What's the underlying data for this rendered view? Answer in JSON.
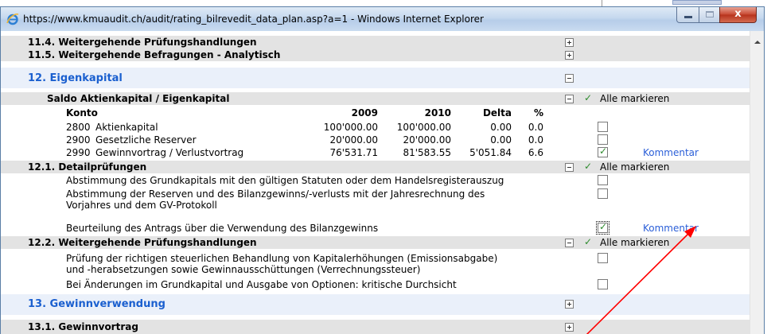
{
  "window": {
    "title": "https://www.kmuaudit.ch/audit/rating_bilrevedit_data_plan.asp?a=1 - Windows Internet Explorer",
    "minimize_icon": "minimize-icon",
    "maximize_icon": "maximize-icon",
    "close_icon": "close-icon",
    "close_glyph": "x"
  },
  "colors": {
    "section_title": "#1a5fcf",
    "check": "#2e8b2e",
    "link": "#2b5fd8",
    "annotation_arrow": "#ff0000"
  },
  "rows": {
    "r11_4": "11.4.  Weitergehende Prüfungshandlungen",
    "r11_5": "11.5.  Weitergehende Befragungen - Analytisch",
    "r12": "12. Eigenkapital",
    "saldo": "Saldo Aktienkapital / Eigenkapital",
    "mark_all": "Alle markieren",
    "comment": "Kommentar",
    "r12_1": "12.1.  Detailprüfungen",
    "r12_2": "12.2.  Weitergehende Prüfungshandlungen",
    "r13": "13. Gewinnverwendung",
    "r13_1": "13.1.  Gewinnvortrag"
  },
  "table": {
    "headers": {
      "konto": "Konto",
      "y2009": "2009",
      "y2010": "2010",
      "delta": "Delta",
      "pct": "%"
    },
    "rows": [
      {
        "konto": "2800",
        "name": "Aktienkapital",
        "y2009": "100'000.00",
        "y2010": "100'000.00",
        "delta": "0.00",
        "pct": "0.0",
        "checked": false
      },
      {
        "konto": "2900",
        "name": "Gesetzliche Reserver",
        "y2009": "20'000.00",
        "y2010": "20'000.00",
        "delta": "0.00",
        "pct": "0.0",
        "checked": false
      },
      {
        "konto": "2990",
        "name": "Gewinnvortrag / Verlustvortrag",
        "y2009": "76'531.71",
        "y2010": "81'583.55",
        "delta": "5'051.84",
        "pct": "6.6",
        "checked": true
      }
    ]
  },
  "detail_items": [
    "Abstimmung des Grundkapitals mit den gültigen Statuten oder dem Handelsregisterauszug",
    "Abstimmung der Reserven und des Bilanzgewinns/-verlusts mit der Jahresrechnung des",
    "Vorjahres und dem GV-Protokoll",
    "Beurteilung des Antrags über die Verwendung des Bilanzgewinns"
  ],
  "further_items": [
    "Prüfung der richtigen steuerlichen Behandlung von Kapitalerhöhungen (Emissionsabgabe)",
    "und -herabsetzungen sowie Gewinnausschüttungen (Verrechnungssteuer)",
    "Bei Änderungen im Grundkapital und Ausgabe von Optionen: kritische Durchsicht"
  ]
}
